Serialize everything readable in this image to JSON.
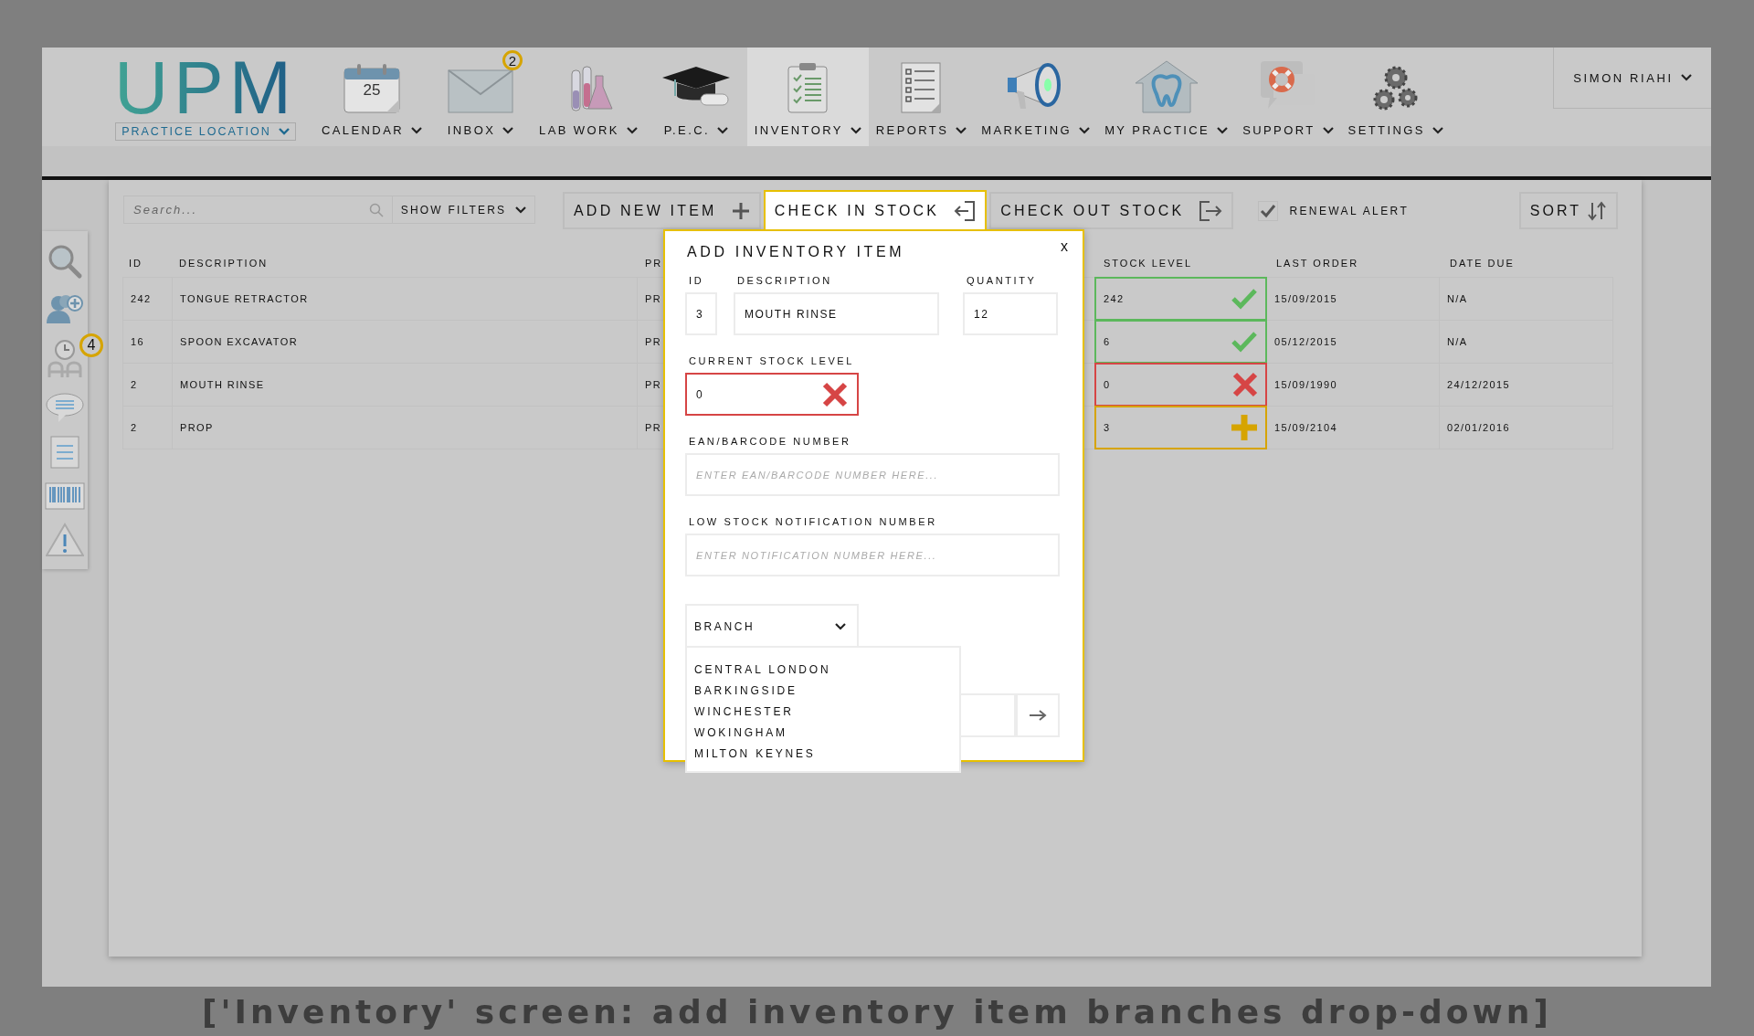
{
  "nav": {
    "logo": "UPM",
    "location": "PRACTICE LOCATION",
    "items": [
      {
        "kind": "calendar",
        "label": "CALENDAR",
        "icon_text": "25",
        "selected": false
      },
      {
        "kind": "inbox",
        "label": "INBOX",
        "badge": "2",
        "selected": false
      },
      {
        "kind": "lab",
        "label": "LAB WORK",
        "selected": false
      },
      {
        "kind": "pec",
        "label": "P.E.C.",
        "selected": false
      },
      {
        "kind": "inventory",
        "label": "INVENTORY",
        "selected": true
      },
      {
        "kind": "reports",
        "label": "REPORTS",
        "selected": false
      },
      {
        "kind": "marketing",
        "label": "MARKETING",
        "selected": false
      },
      {
        "kind": "practice",
        "label": "MY PRACTICE",
        "selected": false
      },
      {
        "kind": "support",
        "label": "SUPPORT",
        "selected": false
      },
      {
        "kind": "settings",
        "label": "SETTINGS",
        "selected": false
      }
    ],
    "user": "SIMON RIAHI"
  },
  "sidebar": {
    "items": [
      {
        "kind": "search"
      },
      {
        "kind": "add-patient"
      },
      {
        "kind": "waiting",
        "badge": "4"
      },
      {
        "kind": "chat"
      },
      {
        "kind": "list"
      },
      {
        "kind": "barcode"
      },
      {
        "kind": "warning"
      }
    ]
  },
  "toolbar": {
    "search": {
      "placeholder": "Search..."
    },
    "filters": "SHOW FILTERS",
    "tabs": [
      {
        "kind": "add",
        "label": "ADD NEW ITEM",
        "selected": false
      },
      {
        "kind": "in",
        "label": "CHECK IN STOCK",
        "selected": true
      },
      {
        "kind": "out",
        "label": "CHECK OUT STOCK",
        "selected": false
      }
    ],
    "renewal": {
      "label": "RENEWAL ALERT",
      "checked": true
    },
    "sort": "SORT"
  },
  "table": {
    "columns": [
      "ID",
      "DESCRIPTION",
      "PR",
      "STOCK LEVEL",
      "LAST ORDER",
      "DATE DUE"
    ],
    "rows": [
      {
        "id": "242",
        "description": "TONGUE RETRACTOR",
        "column_3": "PR",
        "stock": "242",
        "kind": "ok",
        "last_order": "15/09/2015",
        "date_due": "N/A"
      },
      {
        "id": "16",
        "description": "SPOON EXCAVATOR",
        "column_3": "PR",
        "stock": "6",
        "kind": "ok",
        "last_order": "05/12/2015",
        "date_due": "N/A"
      },
      {
        "id": "2",
        "description": "MOUTH RINSE",
        "column_3": "PR",
        "stock": "0",
        "kind": "out",
        "last_order": "15/09/1990",
        "date_due": "24/12/2015"
      },
      {
        "id": "2",
        "description": "PROP",
        "column_3": "PR",
        "stock": "3",
        "kind": "low",
        "last_order": "15/09/2104",
        "date_due": "02/01/2016"
      }
    ]
  },
  "modal": {
    "title": "ADD INVENTORY ITEM",
    "close": "x",
    "id": {
      "label": "ID",
      "value": "3"
    },
    "description": {
      "label": "DESCRIPTION",
      "value": "MOUTH RINSE"
    },
    "quantity": {
      "label": "QUANTITY",
      "value": "12"
    },
    "current_stock": {
      "label": "CURRENT STOCK LEVEL",
      "value": "0",
      "kind": "out"
    },
    "ean": {
      "label": "EAN/BARCODE NUMBER",
      "placeholder": "ENTER EAN/BARCODE NUMBER HERE..."
    },
    "low_stock": {
      "label": "LOW STOCK NOTIFICATION NUMBER",
      "placeholder": "ENTER NOTIFICATION NUMBER HERE..."
    },
    "branch": {
      "label": "BRANCH",
      "expanded": true,
      "options": [
        "CENTRAL LONDON",
        "BARKINGSIDE",
        "WINCHESTER",
        "WOKINGHAM",
        "MILTON KEYNES"
      ]
    }
  },
  "caption": "['Inventory' screen: add inventory item branches drop-down]"
}
